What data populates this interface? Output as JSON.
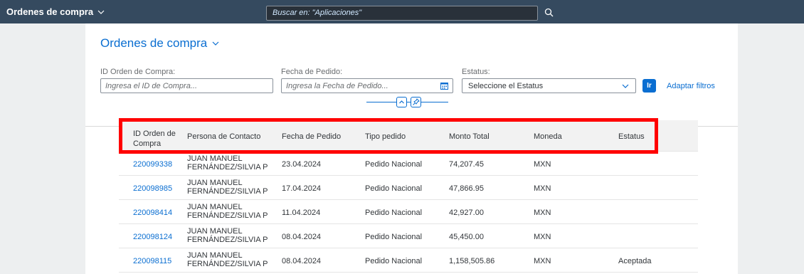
{
  "shell": {
    "title": "Ordenes de compra",
    "search_placeholder": "Buscar en: \"Aplicaciones\""
  },
  "header": {
    "variant_title": "Ordenes de compra"
  },
  "filters": {
    "id_label": "ID Orden de Compra:",
    "id_placeholder": "Ingresa el ID de Compra...",
    "date_label": "Fecha de Pedido:",
    "date_placeholder": "Ingresa la Fecha de Pedido...",
    "status_label": "Estatus:",
    "status_value": "Seleccione el Estatus",
    "go_label": "Ir",
    "adapt_label": "Adaptar filtros"
  },
  "table": {
    "columns": [
      "ID Orden de Compra",
      "Persona de Contacto",
      "Fecha de Pedido",
      "Tipo pedido",
      "Monto Total",
      "Moneda",
      "Estatus"
    ],
    "rows": [
      {
        "id": "220099338",
        "contact_1": "JUAN MANUEL",
        "contact_2": "FERNÁNDEZ/SILVIA P",
        "date": "23.04.2024",
        "type": "Pedido Nacional",
        "amount": "74,207.45",
        "currency": "MXN",
        "status": ""
      },
      {
        "id": "220098985",
        "contact_1": "JUAN MANUEL",
        "contact_2": "FERNÁNDEZ/SILVIA P",
        "date": "17.04.2024",
        "type": "Pedido Nacional",
        "amount": "47,866.95",
        "currency": "MXN",
        "status": ""
      },
      {
        "id": "220098414",
        "contact_1": "JUAN MANUEL",
        "contact_2": "FERNÁNDEZ/SILVIA P",
        "date": "11.04.2024",
        "type": "Pedido Nacional",
        "amount": "42,927.00",
        "currency": "MXN",
        "status": ""
      },
      {
        "id": "220098124",
        "contact_1": "JUAN MANUEL",
        "contact_2": "FERNÁNDEZ/SILVIA P",
        "date": "08.04.2024",
        "type": "Pedido Nacional",
        "amount": "45,450.00",
        "currency": "MXN",
        "status": ""
      },
      {
        "id": "220098115",
        "contact_1": "JUAN MANUEL",
        "contact_2": "FERNÁNDEZ/SILVIA P",
        "date": "08.04.2024",
        "type": "Pedido Nacional",
        "amount": "1,158,505.86",
        "currency": "MXN",
        "status": "Aceptada"
      }
    ]
  },
  "colors": {
    "shell_bg": "#354a5f",
    "accent": "#0a6ed1",
    "highlight": "#ff0000"
  }
}
